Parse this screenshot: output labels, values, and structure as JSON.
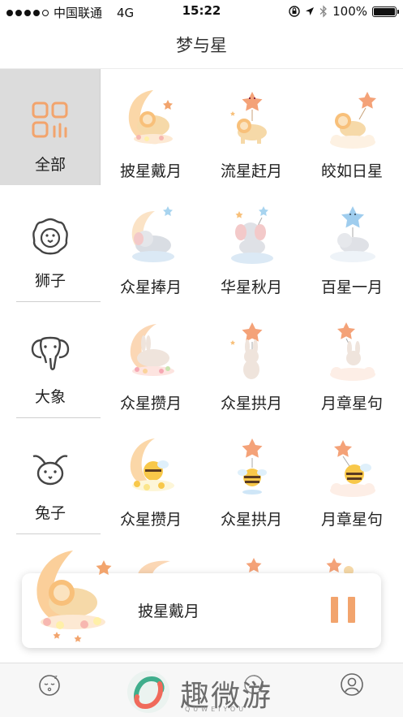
{
  "status_bar": {
    "carrier": "中国联通",
    "network": "4G",
    "time": "15:22",
    "battery": "100%",
    "battery_level": 1.0,
    "signal_bars": 4
  },
  "nav": {
    "title": "梦与星"
  },
  "categories": [
    {
      "label": "全部",
      "icon": "grid-icon",
      "active": true
    },
    {
      "label": "狮子",
      "icon": "lion-icon",
      "active": false
    },
    {
      "label": "大象",
      "icon": "elephant-icon",
      "active": false
    },
    {
      "label": "兔子",
      "icon": "rabbit-icon",
      "active": false
    }
  ],
  "stories": [
    {
      "label": "披星戴月",
      "art": "moon-lion-art"
    },
    {
      "label": "流星赶月",
      "art": "star-lion-art"
    },
    {
      "label": "皎如日星",
      "art": "cloud-lion-art"
    },
    {
      "label": "众星捧月",
      "art": "moon-elephant-art"
    },
    {
      "label": "华星秋月",
      "art": "star-elephant-art"
    },
    {
      "label": "百星一月",
      "art": "cloud-elephant-art"
    },
    {
      "label": "众星攒月",
      "art": "moon-rabbit-art"
    },
    {
      "label": "众星拱月",
      "art": "star-rabbit-art"
    },
    {
      "label": "月章星句",
      "art": "cloud-rabbit-art"
    },
    {
      "label": "众星攒月",
      "art": "moon-bee-art"
    },
    {
      "label": "众星拱月",
      "art": "star-bee-art"
    },
    {
      "label": "月章星句",
      "art": "cloud-bee-art"
    }
  ],
  "player": {
    "title": "披星戴月",
    "state": "playing"
  },
  "tabbar": {
    "tabs": [
      {
        "icon": "sleep-face-icon"
      },
      {
        "icon": "moon-tab-icon"
      },
      {
        "icon": "profile-icon"
      }
    ]
  },
  "watermark": {
    "text": "趣微游",
    "sub": "QUWEIYOU"
  },
  "colors": {
    "accent": "#f2a46d",
    "active_bg": "#dcdcdc"
  }
}
